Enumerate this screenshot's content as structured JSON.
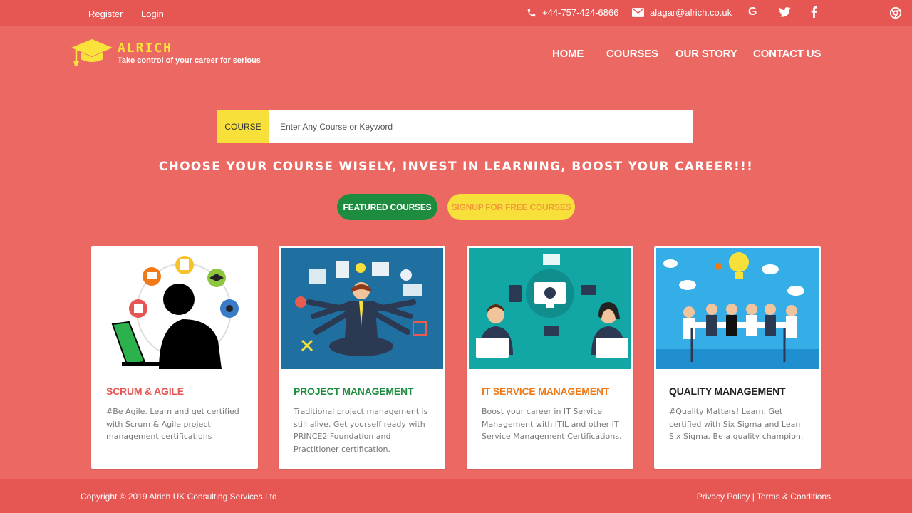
{
  "topbar": {
    "register": "Register",
    "login": "Login",
    "phone": "+44-757-424-6866",
    "email": "alagar@alrich.co.uk",
    "social": [
      "G",
      "t",
      "f"
    ]
  },
  "brand": {
    "name": "ALRICH",
    "tagline": "Take control of your career for serious",
    "color": "#f9e33a"
  },
  "nav": [
    "HOME",
    "COURSES",
    "OUR STORY",
    "CONTACT US"
  ],
  "search": {
    "label": "COURSE",
    "placeholder": "Enter Any Course or Keyword"
  },
  "headline": "CHOOSE YOUR COURSE WISELY, INVEST IN LEARNING, BOOST YOUR CAREER!!!",
  "buttons": {
    "featured": "FEATURED COURSES",
    "signup": "SIGNUP FOR FREE COURSES"
  },
  "cards": [
    {
      "title": "SCRUM & AGILE",
      "color": "#e65653",
      "text": "#Be Agile. Learn and get certified with Scrum & Agile project management certifications"
    },
    {
      "title": "PROJECT MANAGEMENT",
      "color": "#1e8c3f",
      "text": "Traditional project management is still alive. Get yourself ready with PRINCE2 Foundation and Practitioner certification."
    },
    {
      "title": "IT SERVICE MANAGEMENT",
      "color": "#f07a18",
      "text": "Boost your career in IT Service Management with ITIL and other IT Service Management Certifications."
    },
    {
      "title": "QUALITY MANAGEMENT",
      "color": "#222222",
      "text": "#Quality Matters! Learn. Get certified with Six Sigma and Lean Six Sigma. Be a quality champion."
    }
  ],
  "footer": {
    "copyright": "Copyright © 2019 Alrich UK Consulting Services Ltd",
    "privacy": "Privacy Policy",
    "separator": " | ",
    "terms": "Terms & Conditions"
  }
}
